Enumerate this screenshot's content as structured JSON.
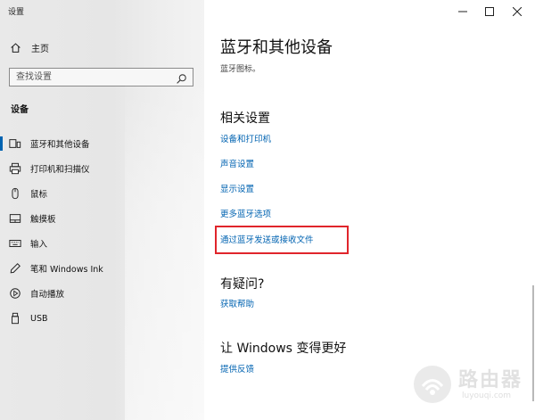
{
  "window": {
    "title": "设置"
  },
  "sidebar": {
    "home_label": "主页",
    "search_placeholder": "查找设置",
    "section_label": "设备",
    "items": [
      {
        "label": "蓝牙和其他设备",
        "icon": "bluetooth-devices-icon",
        "active": true
      },
      {
        "label": "打印机和扫描仪",
        "icon": "printer-icon",
        "active": false
      },
      {
        "label": "鼠标",
        "icon": "mouse-icon",
        "active": false
      },
      {
        "label": "触摸板",
        "icon": "touchpad-icon",
        "active": false
      },
      {
        "label": "输入",
        "icon": "keyboard-icon",
        "active": false
      },
      {
        "label": "笔和 Windows Ink",
        "icon": "pen-icon",
        "active": false
      },
      {
        "label": "自动播放",
        "icon": "autoplay-icon",
        "active": false
      },
      {
        "label": "USB",
        "icon": "usb-icon",
        "active": false
      }
    ]
  },
  "content": {
    "title": "蓝牙和其他设备",
    "description": "蓝牙图标。",
    "related_heading": "相关设置",
    "related_links": [
      "设备和打印机",
      "声音设置",
      "显示设置",
      "更多蓝牙选项",
      "通过蓝牙发送或接收文件"
    ],
    "help_heading": "有疑问?",
    "help_link": "获取帮助",
    "improve_heading": "让 Windows 变得更好",
    "feedback_link": "提供反馈"
  },
  "watermark": {
    "text": "路由器",
    "sub": "luyouqi.com"
  },
  "colors": {
    "accent": "#0063b1",
    "highlight": "#e0252b",
    "sidebar_bg": "#e6e6e6"
  }
}
